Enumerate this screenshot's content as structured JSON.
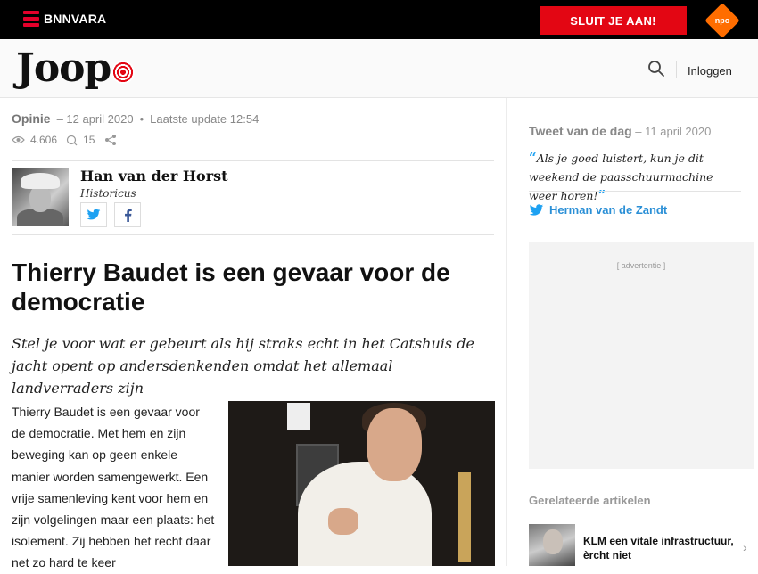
{
  "topbar": {
    "brand": "BNNVARA",
    "join_label": "SLUIT JE AAN!",
    "npo_label": "npo",
    "brand_color": "#e30613"
  },
  "header": {
    "logo_text": "Joop",
    "login_label": "Inloggen",
    "search_icon": "search-icon"
  },
  "article": {
    "section": "Opinie",
    "date": "– 12 april 2020",
    "updated": "Laatste update 12:54",
    "views": "4.606",
    "comments": "15",
    "author_name": "Han van der Horst",
    "author_role": "Historicus",
    "title": "Thierry Baudet is een gevaar voor de democratie",
    "lead": "Stel je voor wat er gebeurt als hij straks echt in het Catshuis de jacht opent op andersdenkenden omdat het allemaal landverraders zijn",
    "body": "Thierry Baudet is een gevaar voor de democratie. Met hem en zijn beweging kan op geen enkele manier worden samengewerkt. Een vrije samenleving kent voor hem en zijn volgelingen maar een plaats: het isolement. Zij hebben het recht daar net zo hard te keer"
  },
  "sidebar": {
    "tweet_label": "Tweet van de dag",
    "tweet_date": "– 11 april 2020",
    "tweet_text": "Als je goed luistert, kun je dit weekend de paasschuurmachine weer horen!",
    "tweet_author": "Herman van de Zandt",
    "ad_label": "[ advertentie ]",
    "related_label": "Gerelateerde artikelen",
    "related_items": [
      {
        "title": "KLM een vitale infrastructuur, èrcht niet"
      }
    ]
  }
}
